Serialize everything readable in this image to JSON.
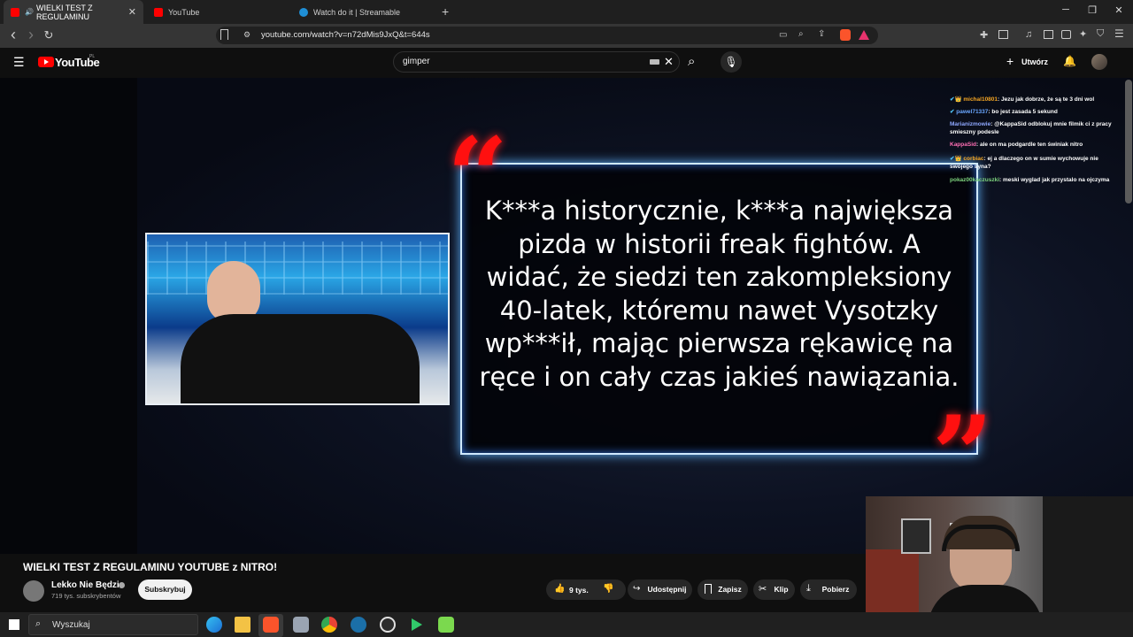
{
  "browser": {
    "tabs": [
      {
        "label": "WIELKI TEST Z REGULAMINU",
        "active": true,
        "color": "#ff0000"
      },
      {
        "label": "YouTube",
        "active": false,
        "color": "#ff0000"
      },
      {
        "label": "Watch do it | Streamable",
        "active": false,
        "color": "#1f8fd6"
      }
    ],
    "new_tab": "+",
    "window_controls": {
      "minimize": "─",
      "maximize": "❐",
      "close": "✕"
    },
    "url": "youtube.com/watch?v=n72dMis9JxQ&t=644s",
    "nav": {
      "back": "‹",
      "forward": "›",
      "reload": "↻"
    }
  },
  "youtube": {
    "logo_text": "YouTube",
    "logo_region": "PL",
    "search_value": "gimper",
    "create_label": "Utwórz"
  },
  "video": {
    "quote": "K***a historycznie, k***a największa pizda w historii freak fightów. A widać, że siedzi ten zakompleksiony 40-latek, któremu nawet Vysotzky wp***ił, mając pierwsza rękawicę na ręce i on cały czas jakieś nawiązania.",
    "quote_open": "“",
    "quote_close": "”",
    "chat": [
      {
        "user": "michal10801",
        "text": "Jezu jak dobrze, że są te 3 dni wol",
        "color": "#f5a623"
      },
      {
        "user": "pawel71337",
        "text": "bo jest zasada 5 sekund",
        "color": "#6aa6ff"
      },
      {
        "user": "Marianizmowie",
        "text": "@KappaSid odblokuj mnie filmik ci z pracy",
        "color": "#8fa8ff"
      },
      {
        "user": "",
        "text": "smieszny podesle",
        "color": "#ffffff"
      },
      {
        "user": "KappaSid",
        "text": "ale on ma podgardle ten świniak nitro",
        "color": "#ff6fb5"
      },
      {
        "user": "corbiac",
        "text": "ej a dlaczego on w sumie wychowuje nie",
        "color": "#f5a623"
      },
      {
        "user": "",
        "text": "swojego syna?",
        "color": "#ffffff"
      },
      {
        "user": "pokaz00kaczuszki",
        "text": "meski wyglad jak przystalo na ojczyma",
        "color": "#7fd67f"
      }
    ]
  },
  "meta": {
    "title": "WIELKI TEST Z REGULAMINU YOUTUBE z NITRO!",
    "channel": "Lekko Nie Będzie",
    "subscribers": "719 tys. subskrybentów",
    "subscribe_label": "Subskrybuj",
    "likes": "9 tys.",
    "share_label": "Udostępnij",
    "save_label": "Zapisz",
    "clip_label": "Klip",
    "download_label": "Pobierz"
  },
  "taskbar": {
    "search_placeholder": "Wyszukaj"
  }
}
